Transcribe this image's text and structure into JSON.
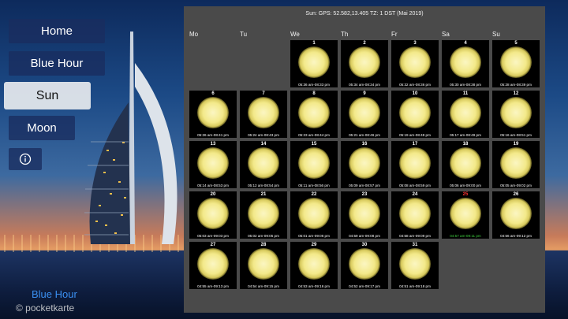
{
  "nav": {
    "home": "Home",
    "blue_hour": "Blue Hour",
    "sun": "Sun",
    "moon": "Moon",
    "info_icon": "info-icon"
  },
  "footer": {
    "link": "Blue Hour",
    "watermark": "© pocketkarte"
  },
  "calendar": {
    "title": "Sun: GPS: 52.582,13.405 TZ: 1 DST (Mai 2019)",
    "weekdays": [
      "Mo",
      "Tu",
      "We",
      "Th",
      "Fr",
      "Sa",
      "Su"
    ],
    "highlight_color": "#3fd23f",
    "today_color": "#ff3333",
    "days": [
      {
        "day": "1",
        "times": "05:36 am-08:33 pm",
        "col": 2,
        "row": 0
      },
      {
        "day": "2",
        "times": "05:34 am-08:34 pm",
        "col": 3,
        "row": 0
      },
      {
        "day": "3",
        "times": "05:32 am-08:36 pm",
        "col": 4,
        "row": 0
      },
      {
        "day": "4",
        "times": "05:30 am-08:38 pm",
        "col": 5,
        "row": 0
      },
      {
        "day": "5",
        "times": "05:28 am-08:39 pm",
        "col": 6,
        "row": 0
      },
      {
        "day": "6",
        "times": "05:26 am-08:41 pm",
        "col": 0,
        "row": 1
      },
      {
        "day": "7",
        "times": "05:24 am-08:43 pm",
        "col": 1,
        "row": 1
      },
      {
        "day": "8",
        "times": "05:23 am-08:44 pm",
        "col": 2,
        "row": 1
      },
      {
        "day": "9",
        "times": "05:21 am-08:46 pm",
        "col": 3,
        "row": 1
      },
      {
        "day": "10",
        "times": "05:19 am-08:48 pm",
        "col": 4,
        "row": 1
      },
      {
        "day": "11",
        "times": "05:17 am-08:49 pm",
        "col": 5,
        "row": 1
      },
      {
        "day": "12",
        "times": "05:16 am-08:51 pm",
        "col": 6,
        "row": 1
      },
      {
        "day": "13",
        "times": "05:14 am-08:53 pm",
        "col": 0,
        "row": 2
      },
      {
        "day": "14",
        "times": "05:12 am-08:54 pm",
        "col": 1,
        "row": 2
      },
      {
        "day": "15",
        "times": "05:11 am-08:56 pm",
        "col": 2,
        "row": 2
      },
      {
        "day": "16",
        "times": "05:09 am-08:57 pm",
        "col": 3,
        "row": 2
      },
      {
        "day": "17",
        "times": "05:08 am-08:59 pm",
        "col": 4,
        "row": 2
      },
      {
        "day": "18",
        "times": "05:06 am-09:00 pm",
        "col": 5,
        "row": 2
      },
      {
        "day": "19",
        "times": "05:05 am-09:02 pm",
        "col": 6,
        "row": 2
      },
      {
        "day": "20",
        "times": "05:03 am-09:03 pm",
        "col": 0,
        "row": 3
      },
      {
        "day": "21",
        "times": "05:02 am-09:05 pm",
        "col": 1,
        "row": 3
      },
      {
        "day": "22",
        "times": "05:01 am-09:06 pm",
        "col": 2,
        "row": 3
      },
      {
        "day": "23",
        "times": "04:59 am-09:08 pm",
        "col": 3,
        "row": 3
      },
      {
        "day": "24",
        "times": "04:58 am-09:09 pm",
        "col": 4,
        "row": 3
      },
      {
        "day": "25",
        "times": "04:57 am-09:11 pm",
        "col": 5,
        "row": 3,
        "today": true
      },
      {
        "day": "26",
        "times": "04:56 am-09:12 pm",
        "col": 6,
        "row": 3
      },
      {
        "day": "27",
        "times": "04:55 am-09:13 pm",
        "col": 0,
        "row": 4
      },
      {
        "day": "28",
        "times": "04:54 am-09:15 pm",
        "col": 1,
        "row": 4
      },
      {
        "day": "29",
        "times": "04:53 am-09:16 pm",
        "col": 2,
        "row": 4
      },
      {
        "day": "30",
        "times": "04:52 am-09:17 pm",
        "col": 3,
        "row": 4
      },
      {
        "day": "31",
        "times": "04:51 am-09:18 pm",
        "col": 4,
        "row": 4
      }
    ]
  }
}
